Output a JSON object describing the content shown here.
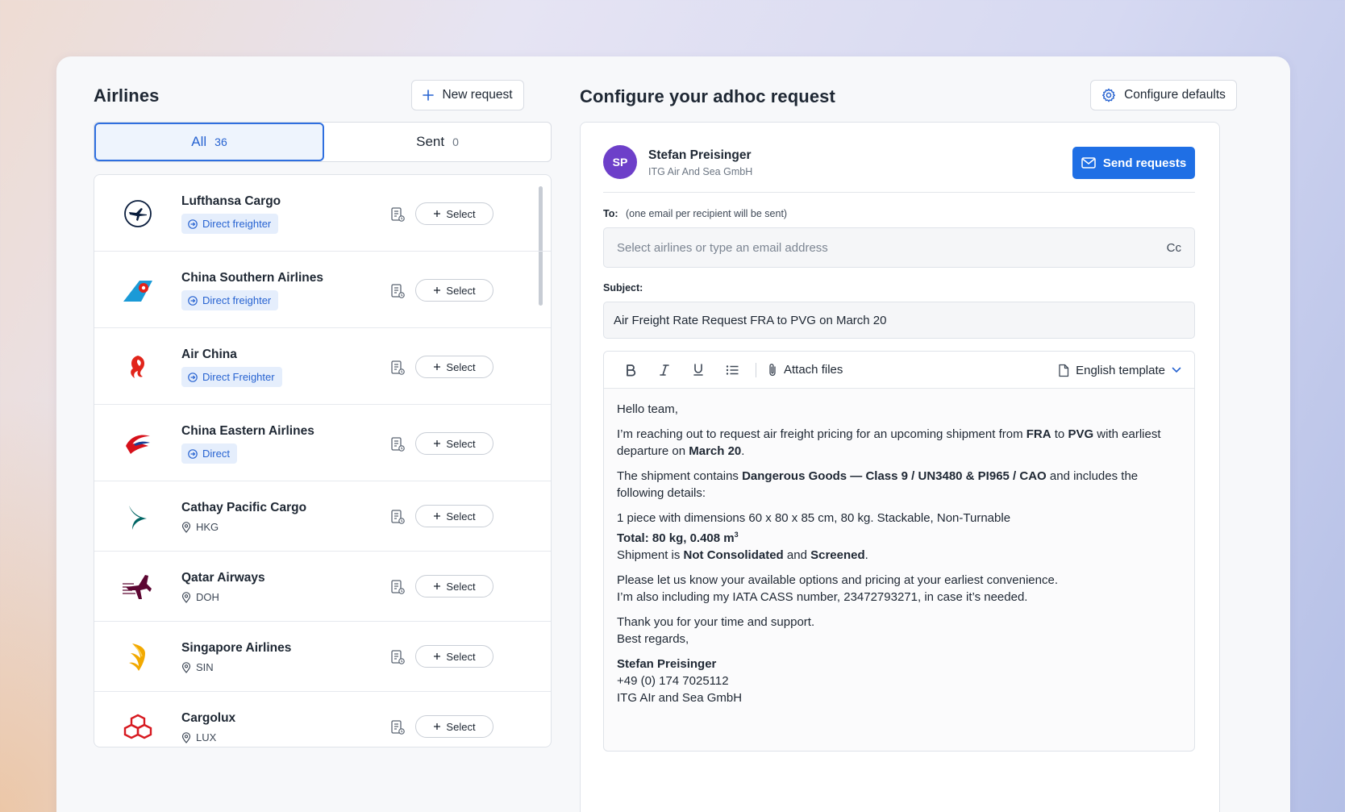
{
  "airlines_panel": {
    "title": "Airlines",
    "new_request_label": "New request",
    "tabs": [
      {
        "label": "All",
        "count": "36"
      },
      {
        "label": "Sent",
        "count": "0"
      }
    ],
    "select_label": "Select",
    "items": [
      {
        "name": "Lufthansa Cargo",
        "tag": "Direct freighter",
        "tag_type": "badge",
        "logo": "lufthansa-crane"
      },
      {
        "name": "China Southern Airlines",
        "tag": "Direct freighter",
        "tag_type": "badge",
        "logo": "china-southern-kapok"
      },
      {
        "name": "Air China",
        "tag": "Direct Freighter",
        "tag_type": "badge",
        "logo": "air-china-phoenix"
      },
      {
        "name": "China Eastern Airlines",
        "tag": "Direct",
        "tag_type": "badge",
        "logo": "china-eastern-swallow"
      },
      {
        "name": "Cathay Pacific Cargo",
        "tag": "HKG",
        "tag_type": "location",
        "logo": "cathay-brushwing"
      },
      {
        "name": "Qatar Airways",
        "tag": "DOH",
        "tag_type": "location",
        "logo": "qatar-oryx"
      },
      {
        "name": "Singapore Airlines",
        "tag": "SIN",
        "tag_type": "location",
        "logo": "singapore-bird"
      },
      {
        "name": "Cargolux",
        "tag": "LUX",
        "tag_type": "location",
        "logo": "cargolux-cubes"
      }
    ]
  },
  "request_panel": {
    "title": "Configure your adhoc request",
    "configure_defaults_label": "Configure defaults",
    "sender": {
      "initials": "SP",
      "name": "Stefan Preisinger",
      "company": "ITG Air And Sea GmbH"
    },
    "send_label": "Send requests",
    "to_label": "To:",
    "to_hint": "(one email per recipient will be sent)",
    "to_placeholder": "Select airlines or type an email address",
    "cc_label": "Cc",
    "subject_label": "Subject:",
    "subject_value": "Air Freight Rate Request FRA to PVG on March 20",
    "toolbar": {
      "attach_label": "Attach files",
      "template_label": "English template"
    },
    "body": {
      "greeting": "Hello team,",
      "p1_a": "I’m reaching out to request air freight pricing for an upcoming shipment from ",
      "p1_origin": "FRA",
      "p1_b": " to ",
      "p1_dest": "PVG",
      "p1_c": " with earliest departure on ",
      "p1_date": "March 20",
      "p1_d": ".",
      "p2_a": "The shipment contains ",
      "p2_goods": "Dangerous Goods — Class 9 / UN3480 & PI965 / CAO",
      "p2_b": " and includes the following details:",
      "dims": "1 piece with dimensions 60 x 80 x 85 cm, 80 kg. Stackable, Non-Turnable",
      "total_a": "Total: 80 kg, 0.408 m",
      "total_sup": "3",
      "ship_a": "Shipment is ",
      "ship_consol": "Not Consolidated",
      "ship_b": " and ",
      "ship_screened": "Screened",
      "ship_c": ".",
      "p4_line1": "Please let us know your available options and pricing at your earliest convenience.",
      "p4_line2": "I’m also including my IATA CASS number, 23472793271, in case it’s needed.",
      "thanks": "Thank you for your time and support.",
      "regards": "Best regards,",
      "sig_name": "Stefan Preisinger",
      "sig_phone": "+49 (0) 174 7025112",
      "sig_company": "ITG AIr and Sea GmbH"
    }
  },
  "colors": {
    "accent": "#1f6fe5",
    "avatar": "#6d3fc9",
    "badge_bg": "#e5eefc",
    "badge_text": "#2763d1"
  }
}
